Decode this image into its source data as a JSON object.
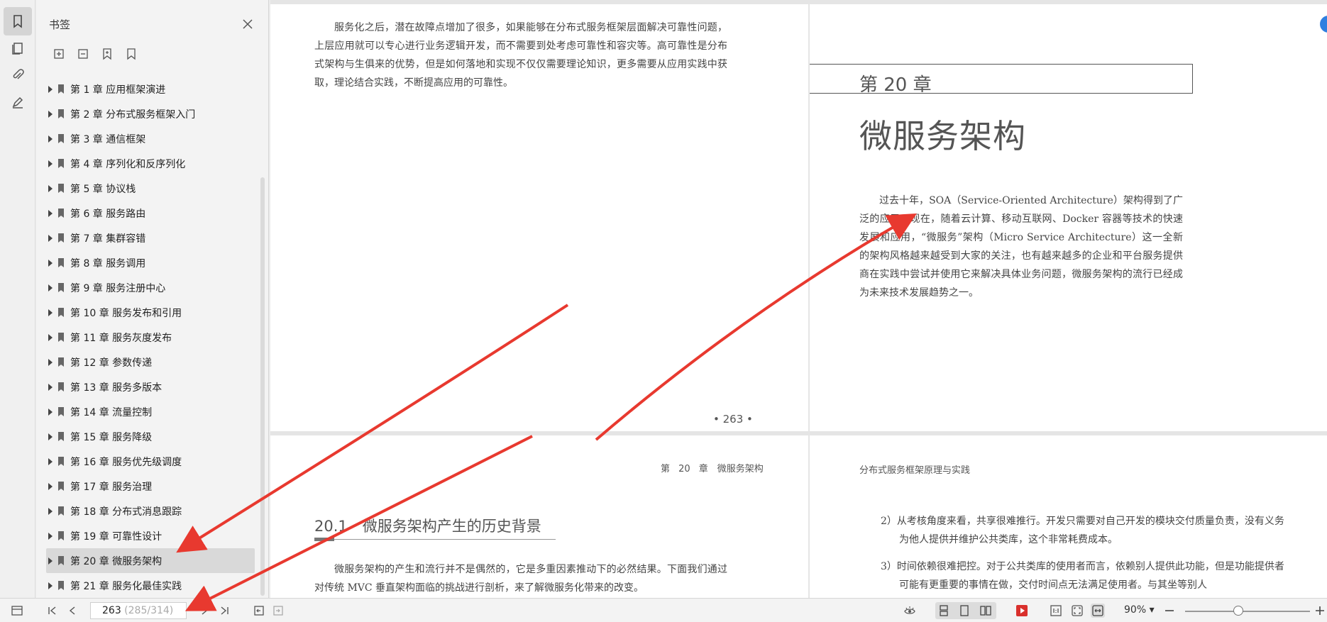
{
  "sidebar": {
    "title": "书签",
    "items": [
      {
        "label": "第 1 章 应用框架演进"
      },
      {
        "label": "第 2 章 分布式服务框架入门"
      },
      {
        "label": "第 3 章 通信框架"
      },
      {
        "label": "第 4 章 序列化和反序列化"
      },
      {
        "label": "第 5 章 协议栈"
      },
      {
        "label": "第 6 章 服务路由"
      },
      {
        "label": "第 7 章 集群容错"
      },
      {
        "label": "第 8 章 服务调用"
      },
      {
        "label": "第 9 章 服务注册中心"
      },
      {
        "label": "第 10 章 服务发布和引用"
      },
      {
        "label": "第 11 章 服务灰度发布"
      },
      {
        "label": "第 12 章 参数传递"
      },
      {
        "label": "第 13 章 服务多版本"
      },
      {
        "label": "第 14 章 流量控制"
      },
      {
        "label": "第 15 章 服务降级"
      },
      {
        "label": "第 16 章 服务优先级调度"
      },
      {
        "label": "第 17 章 服务治理"
      },
      {
        "label": "第 18 章 分布式消息跟踪"
      },
      {
        "label": "第 19 章 可靠性设计"
      },
      {
        "label": "第 20 章 微服务架构"
      },
      {
        "label": "第 21 章 服务化最佳实践"
      }
    ]
  },
  "pages": {
    "p1": {
      "body": "服务化之后，潜在故障点增加了很多，如果能够在分布式服务框架层面解决可靠性问题，上层应用就可以专心进行业务逻辑开发，而不需要到处考虑可靠性和容灾等。高可靠性是分布式架构与生俱来的优势，但是如何落地和实现不仅仅需要理论知识，更多需要从应用实践中获取，理论结合实践，不断提高应用的可靠性。",
      "page_number": "• 263 •"
    },
    "p2": {
      "chapter_label": "第 20 章",
      "chapter_title": "微服务架构",
      "body": "过去十年，SOA（Service-Oriented Architecture）架构得到了广泛的应用，现在，随着云计算、移动互联网、Docker 容器等技术的快速发展和应用，“微服务”架构（Micro Service Architecture）这一全新的架构风格越来越受到大家的关注，也有越来越多的企业和平台服务提供商在实践中尝试并使用它来解决具体业务问题，微服务架构的流行已经成为未来技术发展趋势之一。"
    },
    "p3": {
      "running_head": "第 20 章　微服务架构",
      "section_title": "20.1　微服务架构产生的历史背景",
      "body": "微服务架构的产生和流行并不是偶然的，它是多重因素推动下的必然结果。下面我们通过对传统 MVC 垂直架构面临的挑战进行剖析，来了解微服务化带来的改变。"
    },
    "p4": {
      "running_head": "分布式服务框架原理与实践",
      "item1": "2）从考核角度来看，共享很难推行。开发只需要对自己开发的模块交付质量负责，没有义务为他人提供并维护公共类库，这个非常耗费成本。",
      "item2": "3）时间依赖很难把控。对于公共类库的使用者而言，依赖别人提供此功能，但是功能提供者可能有更重要的事情在做，交付时间点无法满足使用者。与其坐等别人"
    }
  },
  "statusbar": {
    "page_current": "263",
    "page_info": " (285/314)",
    "zoom": "90%"
  },
  "colors": {
    "accent_red": "#e8392f",
    "selected_bg": "#d9d9d9",
    "blue_dot": "#2f7fe0"
  }
}
